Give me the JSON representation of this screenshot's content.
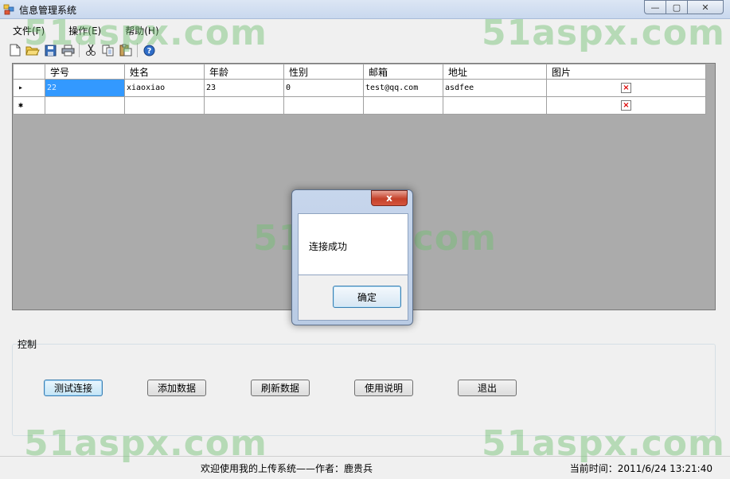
{
  "window": {
    "title": "信息管理系统",
    "controls": {
      "minimize": "—",
      "maximize": "▢",
      "close": "✕"
    }
  },
  "menu": [
    {
      "label": "文件(F)"
    },
    {
      "label": "操作(E)"
    },
    {
      "label": "帮助(H)"
    }
  ],
  "toolbar": [
    "new-icon",
    "open-icon",
    "save-icon",
    "print-icon",
    "cut-icon",
    "copy-icon",
    "paste-icon",
    "help-icon"
  ],
  "grid": {
    "columns": [
      "学号",
      "姓名",
      "年龄",
      "性别",
      "邮箱",
      "地址",
      "图片"
    ],
    "rows": [
      {
        "indicator": "▸",
        "cells": [
          "22",
          "xiaoxiao",
          "23",
          "0",
          "test@qq.com",
          "asdfee"
        ],
        "image": "broken-image-icon"
      },
      {
        "indicator": "✱",
        "cells": [
          "",
          "",
          "",
          "",
          "",
          ""
        ],
        "image": "broken-image-icon"
      }
    ]
  },
  "dialog": {
    "close": "x",
    "message": "连接成功",
    "ok": "确定"
  },
  "controls": {
    "group_label": "控制",
    "buttons": [
      "测试连接",
      "添加数据",
      "刷新数据",
      "使用说明",
      "退出"
    ]
  },
  "status": {
    "welcome": "欢迎使用我的上传系统——作者：鹿贵兵",
    "time": "当前时间：2011/6/24 13:21:40"
  },
  "watermark": "51aspx.com",
  "colors": {
    "selection": "#3399ff",
    "grid_background": "#ababab",
    "watermark": "#6ebe6e"
  }
}
